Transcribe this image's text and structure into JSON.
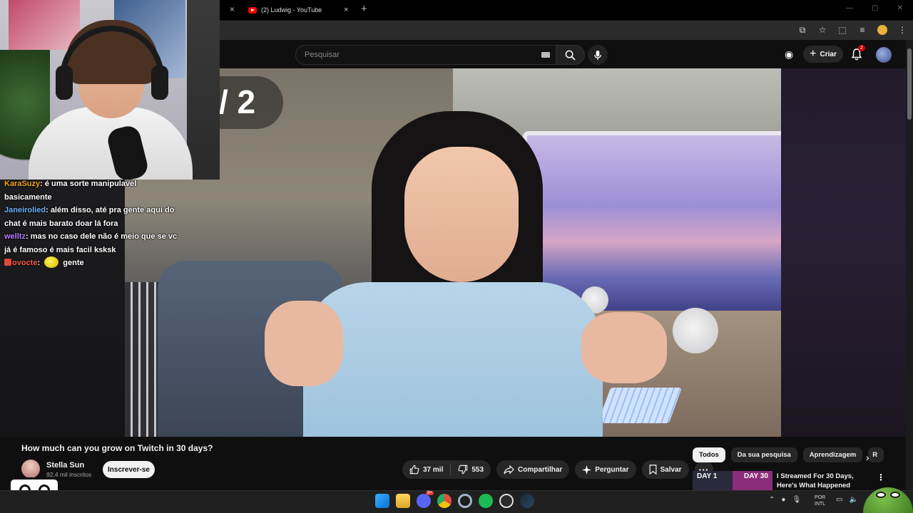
{
  "browser": {
    "tab_title": "(2) Ludwig - YouTube",
    "tab_close": "×",
    "other_tab_close": "×",
    "new_tab": "+"
  },
  "youtube": {
    "search_placeholder": "Pesquisar",
    "create_label": "Criar",
    "notification_count": "2"
  },
  "video_overlay": {
    "counter_text": "/ 2"
  },
  "chat": [
    {
      "user": "KaraSuzy",
      "user_color": "#f2a51a",
      "message": "é uma sorte manipulavel basicamente"
    },
    {
      "user": "Janeirolied",
      "user_color": "#6fb1ff",
      "message": "além disso, até pra gente aqui do chat é mais barato doar lá fora"
    },
    {
      "user": "welltz",
      "user_color": "#b27cff",
      "message": "mas no caso dele não é meio que se vc já é famoso é mais facil ksksk"
    },
    {
      "user": "ovocte",
      "user_color": "#ff5a4a",
      "message": "gente"
    }
  ],
  "video": {
    "title": "How much can you grow on Twitch in 30 days?",
    "channel_name": "Stella Sun",
    "subscribers": "92,4 mil inscritos",
    "subscribe_label": "Inscrever-se",
    "likes": "37 mil",
    "dislikes": "553",
    "share_label": "Compartilhar",
    "ask_label": "Perguntar",
    "save_label": "Salvar"
  },
  "chips": [
    "Todos",
    "Da sua pesquisa",
    "Aprendizagem",
    "R"
  ],
  "recommendation": {
    "day_left": "DAY 1",
    "day_right": "DAY 30",
    "title": "I Streamed For 30 Days, Here's What Happened"
  },
  "taskbar": {
    "lang_line1": "POR",
    "lang_line2": "INTL",
    "discord_badge": "9+"
  },
  "colors": {
    "youtube_red": "#ff0000",
    "background": "#0f0f0f",
    "chip_active": "#f1f1f1"
  }
}
